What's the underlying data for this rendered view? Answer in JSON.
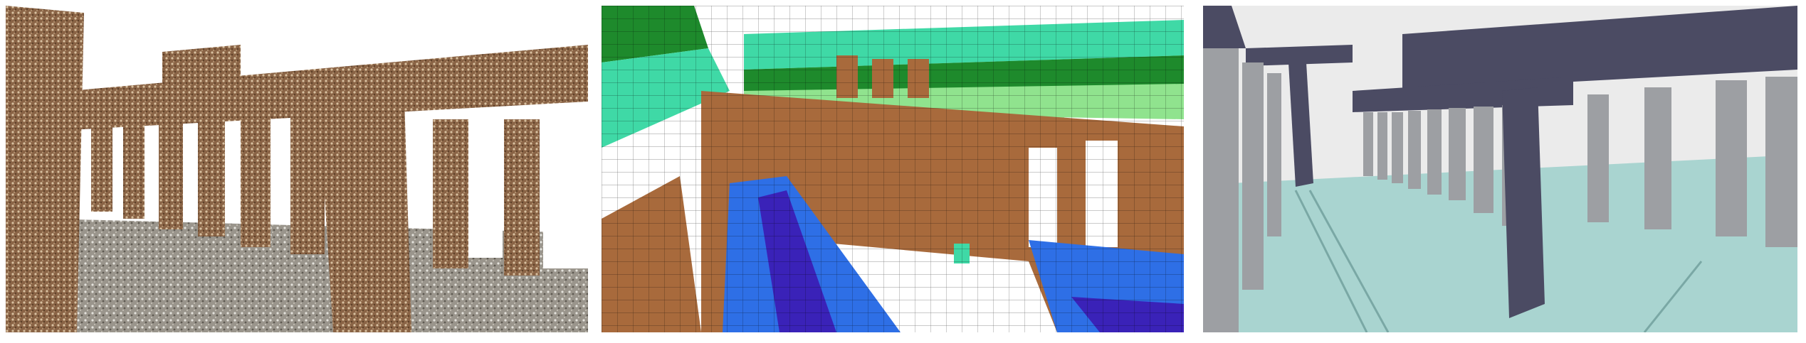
{
  "figure": {
    "panels": [
      {
        "id": "a",
        "kind": "point-cloud-render",
        "subject": "colonnade"
      },
      {
        "id": "b",
        "kind": "semantic-voxel-segmentation",
        "subject": "colonnade"
      },
      {
        "id": "c",
        "kind": "reconstructed-3d-model",
        "subject": "colonnade"
      }
    ],
    "colors": {
      "stone": "#9a7350",
      "voxel_dark_green": "#1e8a2c",
      "voxel_light_green": "#90e38e",
      "voxel_teal": "#3fd9a6",
      "voxel_brown": "#a86a3c",
      "voxel_blue": "#2e6fe6",
      "voxel_deep_blue": "#3a22b8",
      "model_navy": "#4b4b63",
      "model_gray": "#9d9fa3",
      "model_floor": "#a9d4d0"
    }
  }
}
